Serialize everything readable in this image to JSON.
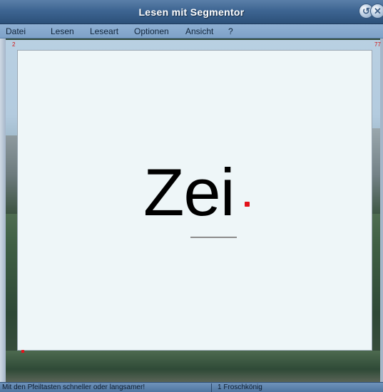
{
  "window": {
    "title": "Lesen mit Segmentor",
    "minimize_glyph": "↺",
    "close_glyph": "✕"
  },
  "menu": {
    "items": [
      "Datei",
      "Lesen",
      "Leseart",
      "Optionen",
      "Ansicht",
      "?"
    ]
  },
  "counters": {
    "left": "2",
    "right": "77"
  },
  "reader": {
    "word": "Zei",
    "accent_color": "#e2121a"
  },
  "status": {
    "hint": "Mit den Pfeiltasten schneller oder langsamer!",
    "file": "1 Froschkönig"
  }
}
